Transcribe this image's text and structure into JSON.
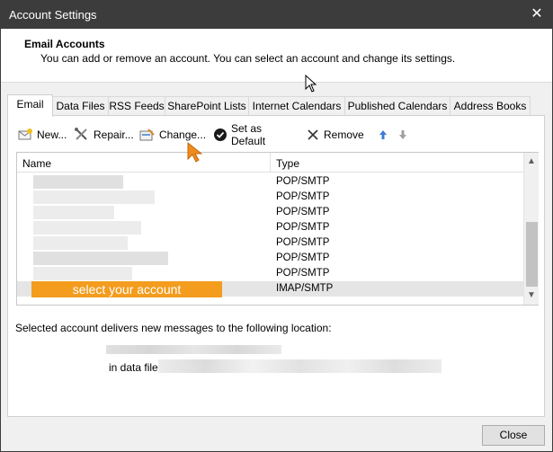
{
  "window": {
    "title": "Account Settings",
    "close_glyph": "✕"
  },
  "header": {
    "title": "Email Accounts",
    "description": "You can add or remove an account. You can select an account and change its settings."
  },
  "tabs": [
    {
      "label": "Email",
      "active": true
    },
    {
      "label": "Data Files",
      "active": false
    },
    {
      "label": "RSS Feeds",
      "active": false
    },
    {
      "label": "SharePoint Lists",
      "active": false
    },
    {
      "label": "Internet Calendars",
      "active": false
    },
    {
      "label": "Published Calendars",
      "active": false
    },
    {
      "label": "Address Books",
      "active": false
    }
  ],
  "toolbar": {
    "new_label": "New...",
    "repair_label": "Repair...",
    "change_label": "Change...",
    "default_label": "Set as Default",
    "remove_label": "Remove"
  },
  "list": {
    "columns": {
      "name": "Name",
      "type": "Type"
    },
    "rows": [
      {
        "type": "POP/SMTP"
      },
      {
        "type": "POP/SMTP"
      },
      {
        "type": "POP/SMTP"
      },
      {
        "type": "POP/SMTP"
      },
      {
        "type": "POP/SMTP"
      },
      {
        "type": "POP/SMTP"
      },
      {
        "type": "POP/SMTP"
      },
      {
        "type": "IMAP/SMTP",
        "selected": true
      }
    ]
  },
  "callout": "select your account",
  "delivery": {
    "text": "Selected account delivers new messages to the following location:",
    "data_file_label": "in data file"
  },
  "footer": {
    "close_label": "Close"
  },
  "colors": {
    "titlebar": "#3c3c3c",
    "callout": "#f39c1e",
    "cursor": "#f08a1c"
  }
}
